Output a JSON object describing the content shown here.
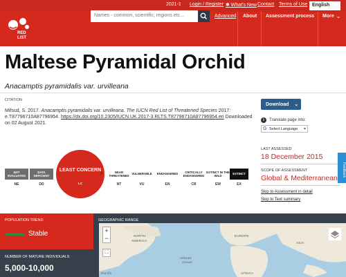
{
  "topbar": {
    "version": "2021-1",
    "login": "Login / Register",
    "whats_new": "✱ What's New",
    "contact": "Contact",
    "terms": "Terms of Use",
    "language": "English"
  },
  "header": {
    "search_placeholder": "Names - common, scientific, regions etc...",
    "advanced": "Advanced",
    "nav": [
      "About",
      "Assessment process",
      "More"
    ]
  },
  "species": {
    "common_name": "Maltese Pyramidal Orchid",
    "scientific_name": "Anacamptis pyramidalis var. urvilleana"
  },
  "citation": {
    "heading": "CITATION",
    "author": "Mifsud, S. 2017. ",
    "species_it": "Anacamptis pyramidalis var. urvilleana",
    "list_it": "The IUCN Red List of Threatened Species",
    "year_code": " 2017: e.T87796710A87796954. ",
    "doi": "https://dx.doi.org/10.2305/IUCN.UK.2017-3.RLTS.T87796710A87796954.en",
    "downloaded": " Downloaded on 02 August 2021."
  },
  "download": {
    "label": "Download",
    "translate": "Translate page into:",
    "select_language": "Select Language"
  },
  "meta": {
    "last_assessed_h": "LAST ASSESSED",
    "last_assessed": "18 December 2015",
    "scope_h": "SCOPE OF ASSESSMENT",
    "scope": "Global & Mediterranean",
    "skip_assessment": "Skip to Assessment in detail",
    "skip_text": "Skip to Text summary",
    "side_tab": "Feedback"
  },
  "categories": [
    {
      "label": "NOT EVALUATED",
      "abbr": "NE"
    },
    {
      "label": "DATA DEFICIENT",
      "abbr": "DD"
    },
    {
      "label": "LEAST CONCERN",
      "abbr": "LC"
    },
    {
      "label": "NEAR THREATENED",
      "abbr": "NT"
    },
    {
      "label": "VULNERABLE",
      "abbr": "VU"
    },
    {
      "label": "ENDANGERED",
      "abbr": "EN"
    },
    {
      "label": "CRITICALLY ENDANGERED",
      "abbr": "CR"
    },
    {
      "label": "EXTINCT IN THE WILD",
      "abbr": "EW"
    },
    {
      "label": "EXTINCT",
      "abbr": "EX"
    }
  ],
  "population": {
    "heading": "POPULATION TREND",
    "trend": "Stable",
    "mature_h": "NUMBER OF MATURE INDIVIDUALS",
    "mature": "5,000-10,000"
  },
  "geo": {
    "heading": "GEOGRAPHIC RANGE",
    "labels": [
      "NORTH",
      "AMERICA",
      "EUROPE",
      "ASIA",
      "Atlantic",
      "Ocean",
      "AFRICA",
      "Pacific"
    ]
  },
  "colors": {
    "red": "#d5291e",
    "dark": "#36404a",
    "blue": "#2a5c8c",
    "stable": "#2d8a3e"
  }
}
